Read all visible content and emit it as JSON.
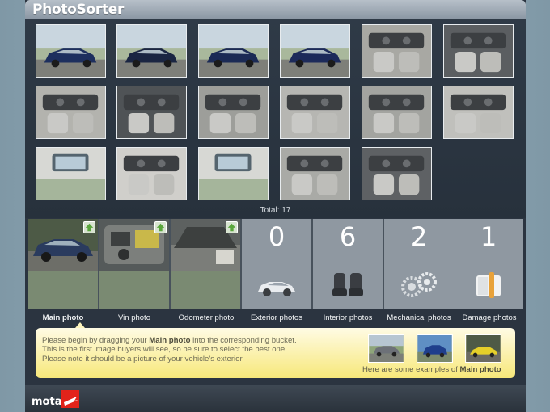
{
  "app": {
    "title": "PhotoSorter"
  },
  "gallery": {
    "total_text": "Total: 17",
    "thumbnails": [
      {
        "subject": "exterior-car-front-three-quarter"
      },
      {
        "subject": "exterior-car-rear"
      },
      {
        "subject": "exterior-car-front"
      },
      {
        "subject": "exterior-car-trunk-open"
      },
      {
        "subject": "interior-dashboard-passenger"
      },
      {
        "subject": "interior-center-console"
      },
      {
        "subject": "interior-door-panel"
      },
      {
        "subject": "interior-vent-closeup"
      },
      {
        "subject": "interior-radio-console"
      },
      {
        "subject": "interior-front-seats"
      },
      {
        "subject": "interior-gear-shift"
      },
      {
        "subject": "interior-rear-seats"
      },
      {
        "subject": "interior-sunroof"
      },
      {
        "subject": "interior-dome-light"
      },
      {
        "subject": "interior-sunroof-open"
      },
      {
        "subject": "interior-door-panel-2"
      },
      {
        "subject": "interior-gear-shift-closeup"
      }
    ]
  },
  "buckets": [
    {
      "label": "Main photo",
      "type": "photo"
    },
    {
      "label": "Vin photo",
      "type": "photo"
    },
    {
      "label": "Odometer photo",
      "type": "photo"
    },
    {
      "label": "Exterior photos",
      "count": "0",
      "icon": "car-icon"
    },
    {
      "label": "Interior photos",
      "count": "6",
      "icon": "seat-icon"
    },
    {
      "label": "Mechanical photos",
      "count": "2",
      "icon": "gears-icon"
    },
    {
      "label": "Damage photos",
      "count": "1",
      "icon": "bandage-icon"
    }
  ],
  "info": {
    "line1_pre": "Please begin by dragging your ",
    "line1_bold": "Main photo",
    "line1_post": " into the corresponding bucket.",
    "line2": "This is the first image buyers will see, so be sure to select the best one.",
    "line3": "Please note it should be a picture of your vehicle's exterior.",
    "examples_pre": "Here are some examples of ",
    "examples_bold": "Main photo"
  },
  "footer": {
    "logo_text": "mota"
  },
  "colors": {
    "background": "#8ea5b2",
    "panel": "#2b3440",
    "info_yellow": "#f7e87a",
    "logo_red": "#e2231a"
  }
}
